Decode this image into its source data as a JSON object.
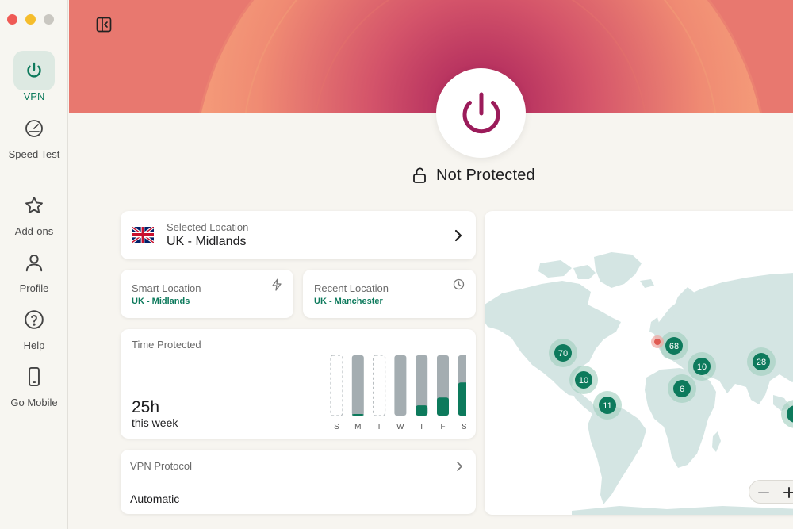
{
  "sidebar": {
    "items": [
      {
        "label": "VPN",
        "icon": "power-icon",
        "active": true
      },
      {
        "label": "Speed Test",
        "icon": "speedometer-icon"
      },
      {
        "label": "Add-ons",
        "icon": "star-icon"
      },
      {
        "label": "Profile",
        "icon": "user-icon"
      },
      {
        "label": "Help",
        "icon": "help-icon"
      },
      {
        "label": "Go Mobile",
        "icon": "mobile-icon"
      }
    ]
  },
  "status": {
    "text": "Not Protected",
    "icon": "unlocked-icon"
  },
  "selected_location": {
    "label": "Selected Location",
    "value": "UK - Midlands",
    "flag": "uk-flag-icon"
  },
  "smart_location": {
    "label": "Smart Location",
    "value": "UK - Midlands",
    "icon": "bolt-icon"
  },
  "recent_location": {
    "label": "Recent Location",
    "value": "UK - Manchester",
    "icon": "clock-icon"
  },
  "time_protected": {
    "label": "Time Protected",
    "hours": "25h",
    "period": "this week",
    "days": [
      {
        "day": "S",
        "fraction": 0,
        "available": false
      },
      {
        "day": "M",
        "fraction": 0.02,
        "available": true
      },
      {
        "day": "T",
        "fraction": 0,
        "available": false
      },
      {
        "day": "W",
        "fraction": 0,
        "available": true
      },
      {
        "day": "T",
        "fraction": 0.17,
        "available": true
      },
      {
        "day": "F",
        "fraction": 0.3,
        "available": true
      },
      {
        "day": "S",
        "fraction": 0.55,
        "available": true
      }
    ]
  },
  "vpn_protocol": {
    "label": "VPN Protocol",
    "value": "Automatic"
  },
  "map": {
    "clusters": [
      "70",
      "10",
      "11",
      "68",
      "10",
      "6",
      "28"
    ]
  },
  "colors": {
    "accent": "#0d7a5c",
    "power": "#9b1b5a",
    "hero_inner": "#b0265a",
    "hero_outer": "#f39a78",
    "map_land": "#d4e5e3"
  }
}
